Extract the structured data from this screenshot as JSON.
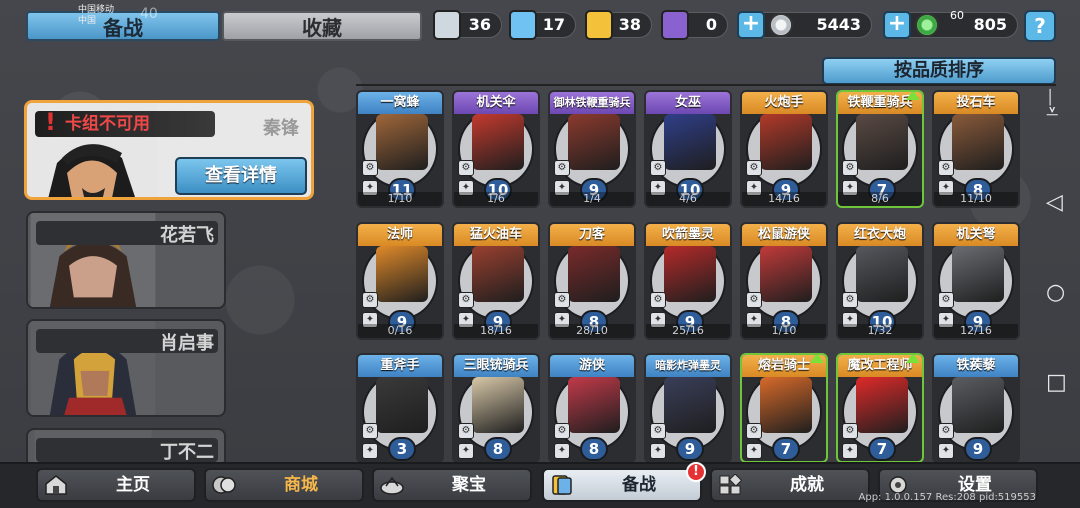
{
  "top_tabs": {
    "active": "备战",
    "inactive": "收藏"
  },
  "status_bar": {
    "carrier": "中国移动",
    "carrier2": "中国",
    "right_text": "60",
    "signal_num": "40"
  },
  "resources": [
    {
      "name": "white-crystal-icon",
      "value": "36",
      "color": "#cfd8df"
    },
    {
      "name": "blue-crystal-icon",
      "value": "17",
      "color": "#6fc2f2"
    },
    {
      "name": "gold-shield-icon",
      "value": "38",
      "color": "#f3c13a"
    },
    {
      "name": "purple-gem-icon",
      "value": "0",
      "color": "#8a62cf"
    },
    {
      "name": "silver-coin-icon",
      "value": "5443",
      "color": "#d8dde2"
    },
    {
      "name": "green-coin-icon",
      "value": "805",
      "color": "#55c25a"
    }
  ],
  "help_label": "?",
  "sort_label": "按品质排序",
  "commanders": [
    {
      "name": "秦锋",
      "warning": "卡组不可用",
      "detail_label": "查看详情",
      "warning_mark": "!"
    },
    {
      "name": "花若飞"
    },
    {
      "name": "肖启事"
    },
    {
      "name": "丁不二"
    }
  ],
  "units": [
    {
      "name": "一窝蜂",
      "level": "11",
      "frac": "1/10",
      "header": "blue",
      "art": "#a0673a",
      "green": false,
      "up": false
    },
    {
      "name": "机关伞",
      "level": "10",
      "frac": "1/6",
      "header": "purple",
      "art": "#c43a2e",
      "green": false,
      "up": false
    },
    {
      "name": "御林铁鞭重骑兵",
      "level": "9",
      "frac": "1/4",
      "header": "purple",
      "art": "#8b3a2e",
      "green": false,
      "up": false
    },
    {
      "name": "女巫",
      "level": "10",
      "frac": "4/6",
      "header": "purple",
      "art": "#2f3f8a",
      "green": false,
      "up": false
    },
    {
      "name": "火炮手",
      "level": "9",
      "frac": "14/16",
      "header": "orange",
      "art": "#b33a2a",
      "green": false,
      "up": false
    },
    {
      "name": "铁鞭重骑兵",
      "level": "7",
      "frac": "8/6",
      "header": "orange",
      "art": "#5a4a44",
      "green": true,
      "up": true
    },
    {
      "name": "投石车",
      "level": "8",
      "frac": "11/10",
      "header": "orange",
      "art": "#8a5a3a",
      "green": false,
      "up": false
    },
    {
      "name": "法师",
      "level": "9",
      "frac": "0/16",
      "header": "orange",
      "art": "#e08a2a",
      "green": false,
      "up": false
    },
    {
      "name": "猛火油车",
      "level": "9",
      "frac": "18/16",
      "header": "orange",
      "art": "#9a4030",
      "green": false,
      "up": false
    },
    {
      "name": "刀客",
      "level": "8",
      "frac": "28/10",
      "header": "orange",
      "art": "#7a2a2a",
      "green": false,
      "up": false
    },
    {
      "name": "吹箭墨灵",
      "level": "9",
      "frac": "25/16",
      "header": "orange",
      "art": "#b52a2a",
      "green": false,
      "up": false
    },
    {
      "name": "松鼠游侠",
      "level": "8",
      "frac": "1/10",
      "header": "orange",
      "art": "#c23a3a",
      "green": false,
      "up": false
    },
    {
      "name": "红衣大炮",
      "level": "10",
      "frac": "1/32",
      "header": "orange",
      "art": "#55585e",
      "green": false,
      "up": false
    },
    {
      "name": "机关弩",
      "level": "9",
      "frac": "12/16",
      "header": "orange",
      "art": "#6a6d72",
      "green": false,
      "up": false
    },
    {
      "name": "重斧手",
      "level": "3",
      "frac": "",
      "header": "blue",
      "art": "#3a3a3a",
      "green": false,
      "up": false
    },
    {
      "name": "三眼铳骑兵",
      "level": "8",
      "frac": "",
      "header": "blue",
      "art": "#d8c8a8",
      "green": false,
      "up": false
    },
    {
      "name": "游侠",
      "level": "8",
      "frac": "",
      "header": "blue",
      "art": "#c23a4a",
      "green": false,
      "up": false
    },
    {
      "name": "暗影炸弹墨灵",
      "level": "9",
      "frac": "",
      "header": "blue",
      "art": "#3a3f5a",
      "green": false,
      "up": false
    },
    {
      "name": "熔岩骑士",
      "level": "7",
      "frac": "",
      "header": "orange",
      "art": "#d86a2a",
      "green": true,
      "up": true
    },
    {
      "name": "魔改工程师",
      "level": "7",
      "frac": "",
      "header": "orange",
      "art": "#e02a2a",
      "green": true,
      "up": true
    },
    {
      "name": "铁蒺藜",
      "level": "9",
      "frac": "",
      "header": "blue",
      "art": "#5a5d62",
      "green": false,
      "up": false
    }
  ],
  "bottom_menu": [
    {
      "label": "主页",
      "icon": "home-icon"
    },
    {
      "label": "商城",
      "icon": "coins-icon"
    },
    {
      "label": "聚宝",
      "icon": "treasure-icon"
    },
    {
      "label": "备战",
      "icon": "deck-icon",
      "badge": "!"
    },
    {
      "label": "成就",
      "icon": "achievement-icon"
    },
    {
      "label": "设置",
      "icon": "gear-icon"
    }
  ],
  "app_info": "App: 1.0.0.157 Res:208 pid:519553"
}
